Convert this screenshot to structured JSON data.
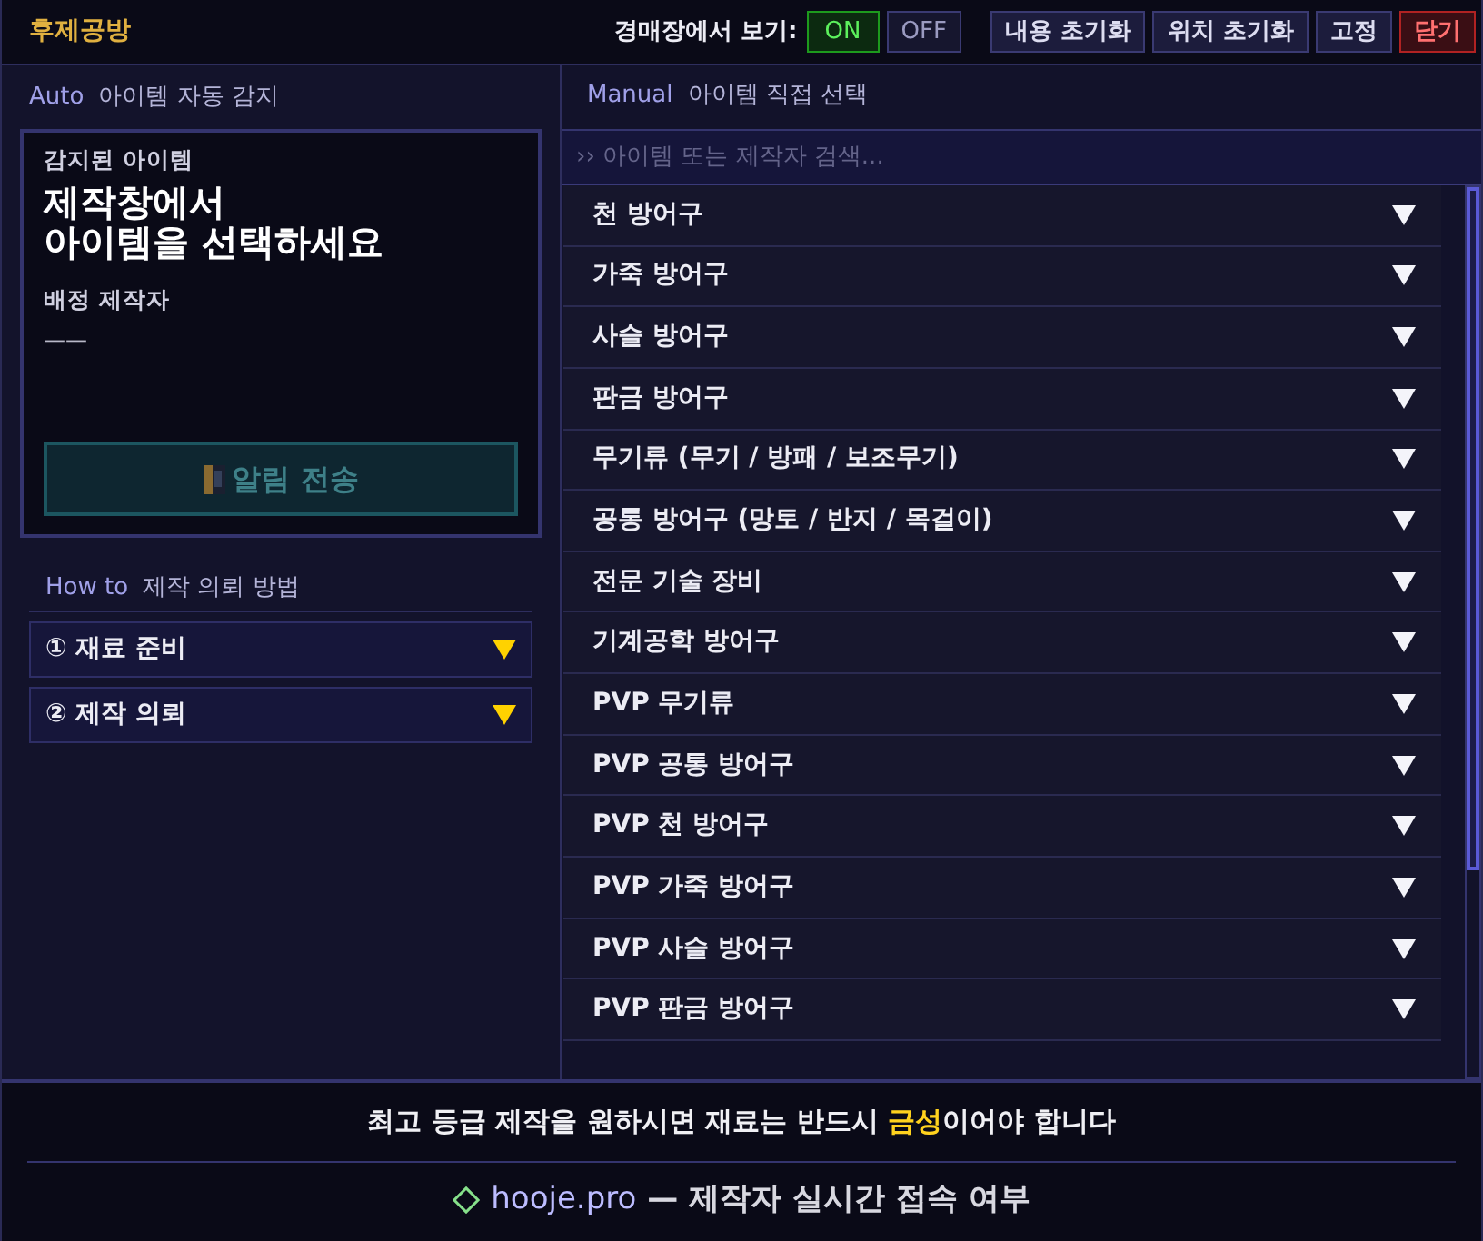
{
  "window": {
    "title": "후제공방"
  },
  "toolbar": {
    "auction_view": {
      "label": "경매장에서 보기:",
      "options": [
        {
          "label": "ON",
          "selected": true
        },
        {
          "label": "OFF",
          "selected": false
        }
      ]
    },
    "buttons": [
      {
        "label": "내용 초기화",
        "kind": "normal"
      },
      {
        "label": "위치 초기화",
        "kind": "normal"
      },
      {
        "label": "고정",
        "kind": "normal"
      },
      {
        "label": "닫기",
        "kind": "danger"
      }
    ]
  },
  "auto_panel": {
    "tag": "Auto",
    "title": "아이템 자동 감지",
    "detected_label": "감지된 아이템",
    "detected_value": "제작창에서\n아이템을 선택하세요",
    "assigned_label": "배정 제작자",
    "assigned_value": "——",
    "send_button": {
      "label": "알림 전송",
      "disabled": true
    }
  },
  "howto": {
    "tag": "How to",
    "title": "제작 의뢰 방법",
    "steps": [
      {
        "label": "① 재료 준비",
        "expanded": false
      },
      {
        "label": "② 제작 의뢰",
        "expanded": false
      }
    ]
  },
  "manual_panel": {
    "tag": "Manual",
    "title": "아이템 직접 선택",
    "search": {
      "placeholder": "›› 아이템 또는 제작자 검색..."
    },
    "categories": [
      {
        "label": "천 방어구",
        "expanded": false
      },
      {
        "label": "가죽 방어구",
        "expanded": false
      },
      {
        "label": "사슬 방어구",
        "expanded": false
      },
      {
        "label": "판금 방어구",
        "expanded": false
      },
      {
        "label": "무기류 (무기 / 방패 / 보조무기)",
        "expanded": false
      },
      {
        "label": "공통 방어구 (망토 / 반지 / 목걸이)",
        "expanded": false
      },
      {
        "label": "전문 기술 장비",
        "expanded": false
      },
      {
        "label": "기계공학 방어구",
        "expanded": false
      },
      {
        "label": "PVP 무기류",
        "expanded": false
      },
      {
        "label": "PVP 공통 방어구",
        "expanded": false
      },
      {
        "label": "PVP 천 방어구",
        "expanded": false
      },
      {
        "label": "PVP 가죽 방어구",
        "expanded": false
      },
      {
        "label": "PVP 사슬 방어구",
        "expanded": false
      },
      {
        "label": "PVP 판금 방어구",
        "expanded": false
      }
    ]
  },
  "footer": {
    "notice": "최고 등급 제작을 원하시면 재료는 반드시 **금성**이어야 합니다",
    "site": "hooje.pro",
    "status_text": "— 제작자 실시간 접속 여부"
  }
}
